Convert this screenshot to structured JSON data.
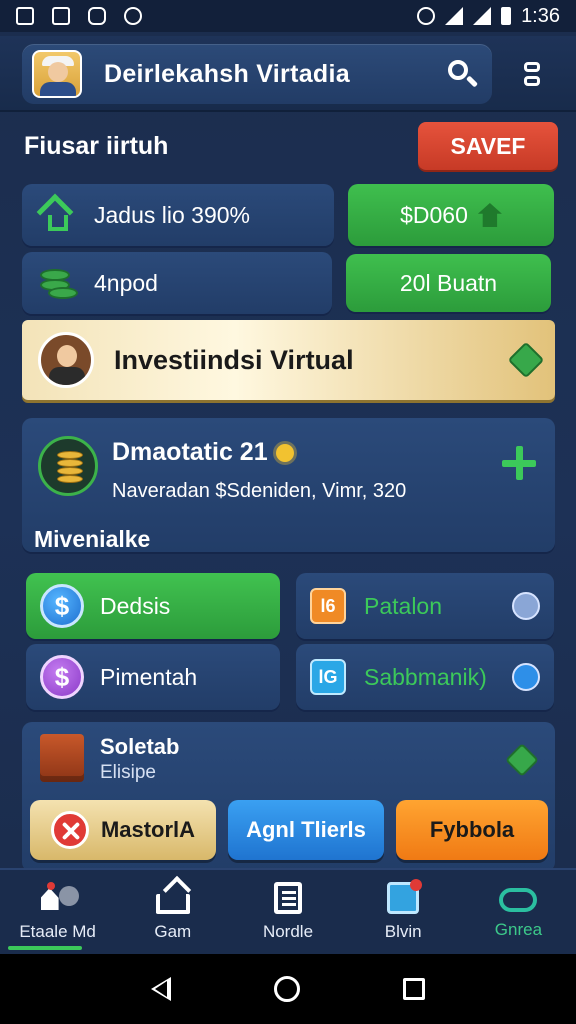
{
  "status_bar": {
    "time": "1:36"
  },
  "header": {
    "title": "Deirlekahsh Virtadia"
  },
  "section": {
    "title": "Fiusar iirtuh",
    "save_label": "SAVEF"
  },
  "stats": [
    {
      "label": "Jadus lio 390%",
      "icon": "house-icon"
    },
    {
      "label": "$D060",
      "icon": "tag-icon"
    },
    {
      "label": "4npod",
      "icon": "coins-icon"
    },
    {
      "label": "20l Buatn"
    }
  ],
  "banner": {
    "title": "Investiindsi Virtual"
  },
  "info": {
    "title": "Dmaotatic 21",
    "description": "Naveradan $Sdeniden, Vimr, 320",
    "subtitle": "Mivenialke"
  },
  "actions": [
    {
      "label": "Dedsis",
      "icon_text": "$"
    },
    {
      "label": "Patalon",
      "icon_text": "l6"
    },
    {
      "label": "Pimentah",
      "icon_text": "$"
    },
    {
      "label": "Sabbmanik)",
      "icon_text": "lG"
    }
  ],
  "bottom_card": {
    "title": "Soletab",
    "subtitle": "Elisipe"
  },
  "pill_buttons": [
    {
      "label": "MastorlA"
    },
    {
      "label": "Agnl Tlierls"
    },
    {
      "label": "Fybbola"
    }
  ],
  "nav": [
    {
      "label": "Etaale Md"
    },
    {
      "label": "Gam"
    },
    {
      "label": "Nordle"
    },
    {
      "label": "Blvin"
    },
    {
      "label": "Gnrea"
    }
  ],
  "colors": {
    "background": "#1d3156",
    "accent_green": "#3cc95a",
    "save_red": "#e6533c",
    "gold": "#e2c27a",
    "blue": "#2f86e4",
    "orange": "#f08a25"
  }
}
